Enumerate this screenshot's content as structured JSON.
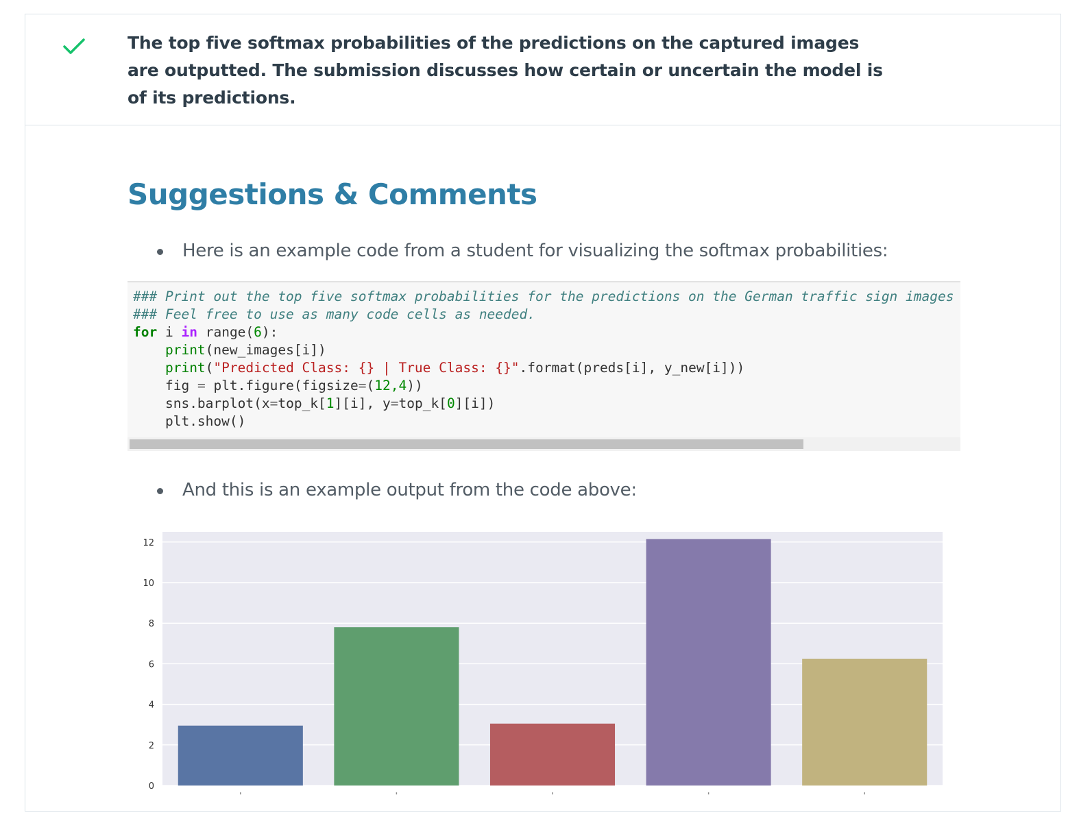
{
  "criterion": {
    "status_icon": "check-icon",
    "status_color": "#02b3e4",
    "text": "The top five softmax probabilities of the predictions on the captured images are outputted. The submission discusses how certain or uncertain the model is of its predictions."
  },
  "suggestions": {
    "heading": "Suggestions & Comments",
    "bullet_1": "Here is an example code from a student for visualizing the softmax probabilities:",
    "bullet_2": "And this is an example output from the code above:"
  },
  "code": {
    "comment_1": "### Print out the top five softmax probabilities for the predictions on the German traffic sign images",
    "comment_2": "### Feel free to use as many code cells as needed.",
    "line_for": {
      "kw": "for",
      "var": "i",
      "in": "in",
      "func": "range",
      "arg": "6"
    },
    "line_print1": {
      "func": "print",
      "args": "new_images[i]"
    },
    "line_print2": {
      "func": "print",
      "string": "\"Predicted Class: {} | True Class: {}\"",
      "rest": ".format(preds[i], y_new[i]))"
    },
    "line_fig": {
      "lhs": "fig",
      "rhs": "plt.figure(figsize",
      "args": "12,4"
    },
    "line_sns": {
      "call": "sns.barplot(x",
      "x_arg": "top_k[",
      "x_idx": "1",
      "x_rest": "][i], y",
      "y_arg": "top_k[",
      "y_idx": "0",
      "y_rest": "][i])"
    },
    "line_show": "plt.show()"
  },
  "chart_data": {
    "type": "bar",
    "ylim": [
      0,
      12.5
    ],
    "yticks": [
      0,
      2,
      4,
      6,
      8,
      10,
      12
    ],
    "values": [
      2.95,
      7.8,
      3.05,
      12.15,
      6.25
    ],
    "colors": [
      "#5975a4",
      "#5f9e6e",
      "#b55d60",
      "#857aab",
      "#c1b37f"
    ],
    "background": "#eaeaf2",
    "grid": true
  }
}
